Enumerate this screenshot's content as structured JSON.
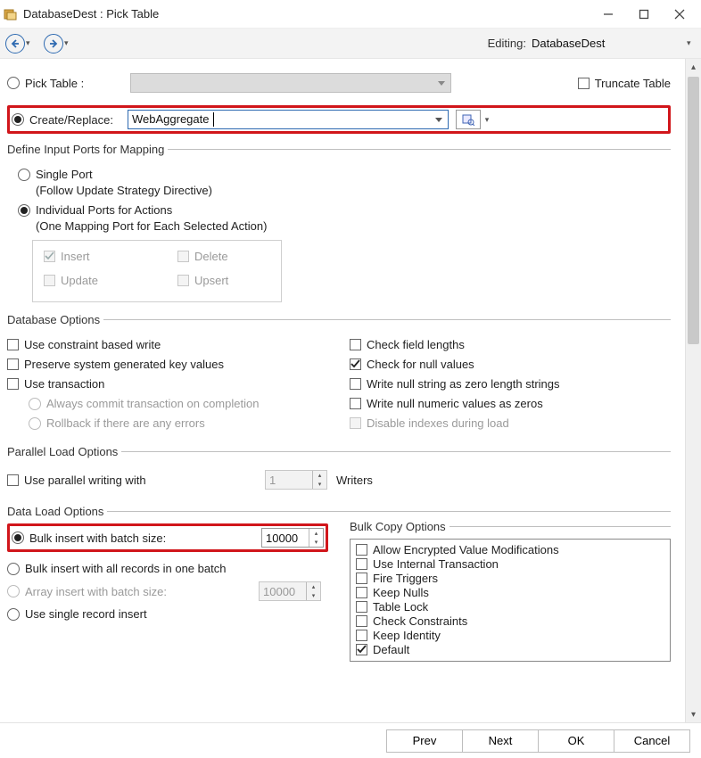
{
  "window": {
    "title": "DatabaseDest : Pick Table"
  },
  "nav": {
    "editing_label": "Editing:",
    "editing_value": "DatabaseDest"
  },
  "top": {
    "pick_table_label": "Pick Table :",
    "create_replace_label": "Create/Replace:",
    "create_replace_value": "WebAggregate",
    "truncate_label": "Truncate Table"
  },
  "ports": {
    "legend": "Define Input Ports for Mapping",
    "single_label": "Single Port",
    "single_hint": "(Follow Update Strategy Directive)",
    "individual_label": "Individual Ports for Actions",
    "individual_hint": "(One Mapping Port for Each Selected Action)",
    "insert": "Insert",
    "update": "Update",
    "delete": "Delete",
    "upsert": "Upsert"
  },
  "dbopts": {
    "legend": "Database  Options",
    "constraint": "Use constraint based write",
    "preserve": "Preserve system generated key values",
    "use_tx": "Use transaction",
    "always_commit": "Always commit transaction on completion",
    "rollback": "Rollback if there are any errors",
    "check_lengths": "Check field lengths",
    "check_nulls": "Check for null values",
    "null_str": "Write null string as zero length strings",
    "null_num": "Write null numeric values as zeros",
    "disable_idx": "Disable indexes during load"
  },
  "parallel": {
    "legend": "Parallel Load Options",
    "use_parallel": "Use parallel writing with",
    "writers_value": "1",
    "writers_label": "Writers"
  },
  "dataload": {
    "legend": "Data Load Options",
    "bulk_batch": "Bulk insert with batch size:",
    "bulk_batch_value": "10000",
    "bulk_all": "Bulk insert with all records in one batch",
    "array_batch": "Array insert with batch size:",
    "array_value": "10000",
    "single": "Use single record insert",
    "bulk_legend": "Bulk Copy Options",
    "bulk_items": [
      "Allow Encrypted Value Modifications",
      "Use Internal Transaction",
      "Fire Triggers",
      "Keep Nulls",
      "Table Lock",
      "Check Constraints",
      "Keep Identity",
      "Default"
    ]
  },
  "footer": {
    "prev": "Prev",
    "next": "Next",
    "ok": "OK",
    "cancel": "Cancel"
  }
}
